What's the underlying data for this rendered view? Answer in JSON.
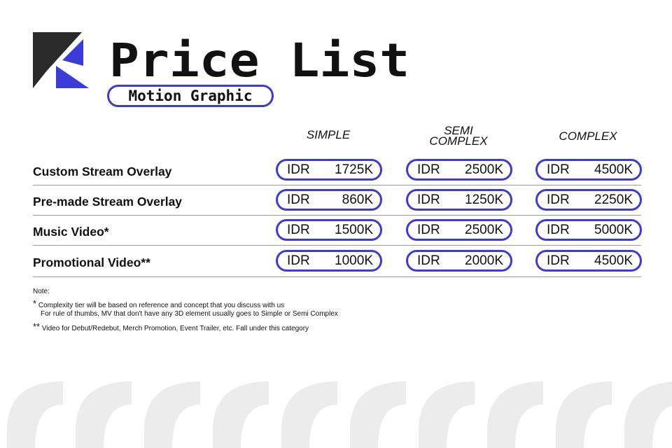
{
  "header": {
    "title": "Price List",
    "subtitle": "Motion Graphic"
  },
  "columns": [
    "SIMPLE",
    "SEMI COMPLEX",
    "COMPLEX"
  ],
  "rows": [
    {
      "label": "Custom Stream Overlay",
      "prices": [
        {
          "currency": "IDR",
          "amount": "1725K"
        },
        {
          "currency": "IDR",
          "amount": "2500K"
        },
        {
          "currency": "IDR",
          "amount": "4500K"
        }
      ]
    },
    {
      "label": "Pre-made Stream Overlay",
      "prices": [
        {
          "currency": "IDR",
          "amount": "860K"
        },
        {
          "currency": "IDR",
          "amount": "1250K"
        },
        {
          "currency": "IDR",
          "amount": "2250K"
        }
      ]
    },
    {
      "label": "Music Video*",
      "prices": [
        {
          "currency": "IDR",
          "amount": "1500K"
        },
        {
          "currency": "IDR",
          "amount": "2500K"
        },
        {
          "currency": "IDR",
          "amount": "5000K"
        }
      ]
    },
    {
      "label": "Promotional Video**",
      "prices": [
        {
          "currency": "IDR",
          "amount": "1000K"
        },
        {
          "currency": "IDR",
          "amount": "2000K"
        },
        {
          "currency": "IDR",
          "amount": "4500K"
        }
      ]
    }
  ],
  "notes": {
    "label": "Note:",
    "note1_mark": "*",
    "note1_line1": "Complexity tier will be based on reference and concept that you discuss with us",
    "note1_line2": "For rule of thumbs, MV that don't have any 3D element usually goes to Simple or Semi Complex",
    "note2_mark": "**",
    "note2_line1": "Video for Debut/Redebut, Merch Promotion, Event Trailer, etc. Fall under this category"
  },
  "colors": {
    "accent": "#3b3bd9",
    "text": "#111111",
    "logo_dark": "#2a2a2a",
    "decoration": "#ececec"
  },
  "icons": [
    "logo-icon"
  ]
}
